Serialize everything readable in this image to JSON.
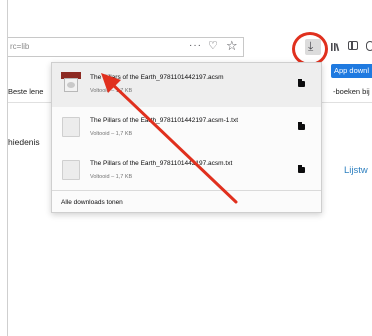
{
  "toolbar": {
    "url_text": "rc=lib",
    "more_glyph": "···",
    "pocket_glyph": "♡",
    "star_glyph": "☆",
    "download_glyph": "⤓"
  },
  "page": {
    "bookmark_left": "Beste lene",
    "app_button": "App downl",
    "bookmark_right": "-boeken bij d",
    "text_left": "hiedenis",
    "link_right": "Lijstw"
  },
  "downloads_panel": {
    "items": [
      {
        "name": "The Pillars of the Earth_9781101442197.acsm",
        "status": "Voltooid – 1,7 KB",
        "icon": "acsm-file-icon"
      },
      {
        "name": "The Pillars of the Earth_9781101442197.acsm-1.txt",
        "status": "Voltooid – 1,7 KB",
        "icon": "text-file-icon"
      },
      {
        "name": "The Pillars of the Earth_9781101442197.acsm.txt",
        "status": "Voltooid – 1,7 KB",
        "icon": "text-file-icon"
      }
    ],
    "show_all_label": "Alle downloads tonen"
  },
  "annotation": {
    "color": "#e0301e"
  }
}
